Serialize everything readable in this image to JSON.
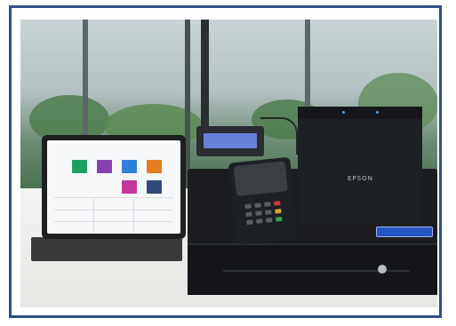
{
  "printer": {
    "brand": "EPSON"
  },
  "tablet": {
    "app_title": "",
    "tiles": [
      {
        "icon": "tile-green",
        "color": "#1e9e63"
      },
      {
        "icon": "tile-purple",
        "color": "#8a3fb0"
      },
      {
        "icon": "tile-blue",
        "color": "#2b82d8"
      },
      {
        "icon": "tile-orange",
        "color": "#e57c20"
      },
      {
        "icon": "tile-magenta",
        "color": "#c2369a"
      },
      {
        "icon": "tile-navy",
        "color": "#2e4a7a"
      }
    ]
  },
  "colors": {
    "frame": "#2f4f86",
    "display": "#6a7fd6",
    "drawer_label": "#2457c5"
  }
}
